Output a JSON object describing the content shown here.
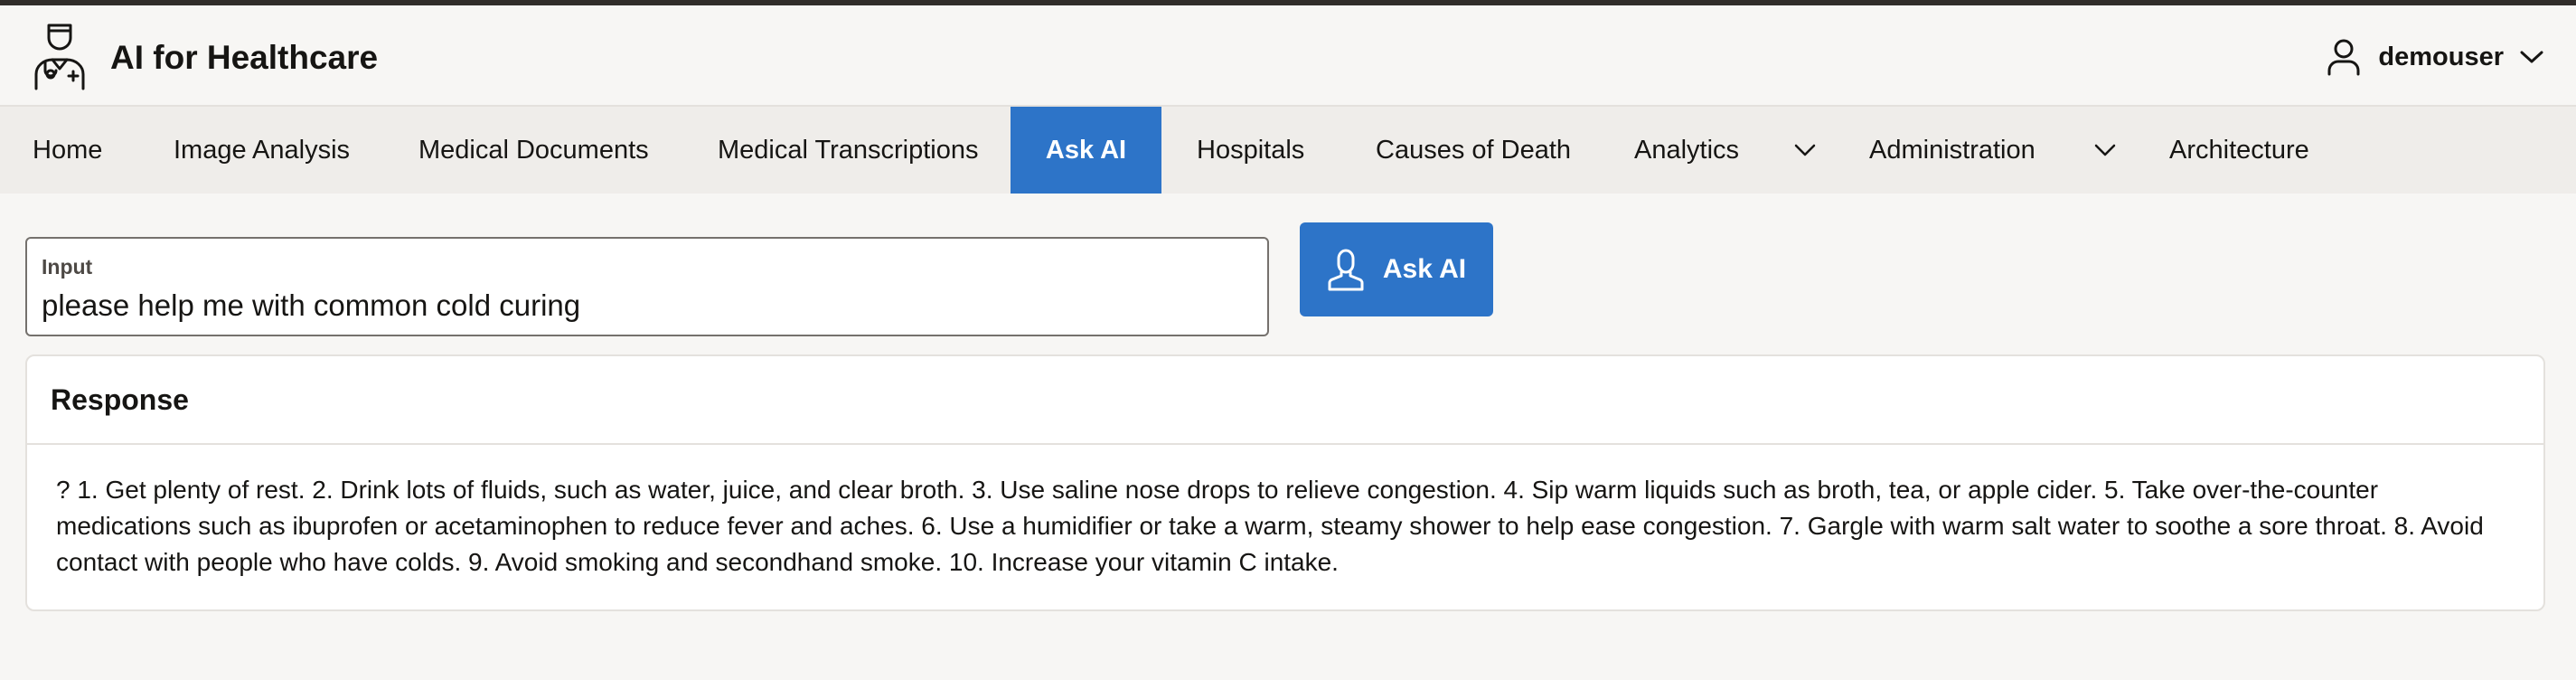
{
  "header": {
    "app_title": "AI for Healthcare",
    "logo_icon": "doctor-icon",
    "username": "demouser",
    "user_icon": "user-icon",
    "user_menu_icon": "chevron-down-icon"
  },
  "nav": {
    "items": [
      {
        "label": "Home"
      },
      {
        "label": "Image Analysis"
      },
      {
        "label": "Medical Documents"
      },
      {
        "label": "Medical Transcriptions"
      },
      {
        "label": "Ask AI",
        "active": true
      },
      {
        "label": "Hospitals"
      },
      {
        "label": "Causes of Death"
      },
      {
        "label": "Analytics",
        "has_submenu": true
      },
      {
        "label": "Administration",
        "has_submenu": true
      },
      {
        "label": "Architecture"
      }
    ]
  },
  "ask": {
    "input_label": "Input",
    "input_value": "please help me with common cold curing",
    "button_label": "Ask AI",
    "button_icon": "person-icon"
  },
  "response": {
    "title": "Response",
    "text": "? 1. Get plenty of rest. 2. Drink lots of fluids, such as water, juice, and clear broth. 3. Use saline nose drops to relieve congestion. 4. Sip warm liquids such as broth, tea, or apple cider. 5. Take over-the-counter medications such as ibuprofen or acetaminophen to reduce fever and aches. 6. Use a humidifier or take a warm, steamy shower to help ease congestion. 7. Gargle with warm salt water to soothe a sore throat. 8. Avoid contact with people who have colds. 9. Avoid smoking and secondhand smoke. 10. Increase your vitamin C intake."
  },
  "colors": {
    "accent": "#2d74c8",
    "background": "#f7f6f4",
    "nav_background": "#efedea"
  }
}
